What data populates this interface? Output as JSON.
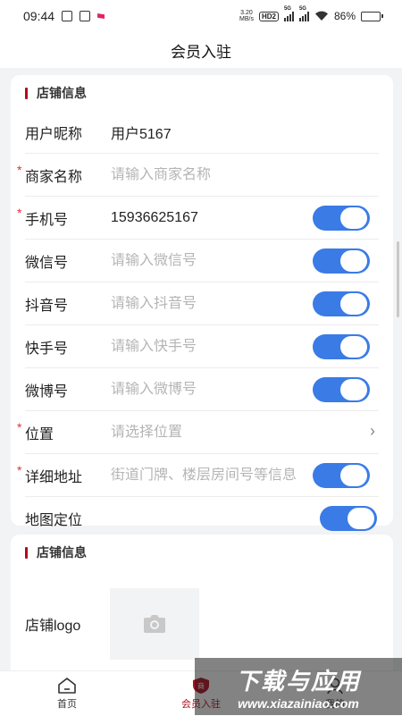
{
  "status_bar": {
    "time": "09:44",
    "net_speed": "3.20\nMB/s",
    "hd": "HD2",
    "signal1": "5G",
    "signal2": "5G",
    "battery": "86%",
    "battery_level": 0.86
  },
  "page": {
    "title": "会员入驻"
  },
  "section1": {
    "title": "店铺信息",
    "fields": [
      {
        "label": "用户昵称",
        "required": false,
        "value": "用户5167",
        "placeholder": "",
        "toggle": null
      },
      {
        "label": "商家名称",
        "required": true,
        "value": "",
        "placeholder": "请输入商家名称",
        "toggle": null
      },
      {
        "label": "手机号",
        "required": true,
        "value": "15936625167",
        "placeholder": "",
        "toggle": true
      },
      {
        "label": "微信号",
        "required": false,
        "value": "",
        "placeholder": "请输入微信号",
        "toggle": true
      },
      {
        "label": "抖音号",
        "required": false,
        "value": "",
        "placeholder": "请输入抖音号",
        "toggle": true
      },
      {
        "label": "快手号",
        "required": false,
        "value": "",
        "placeholder": "请输入快手号",
        "toggle": true
      },
      {
        "label": "微博号",
        "required": false,
        "value": "",
        "placeholder": "请输入微博号",
        "toggle": true
      },
      {
        "label": "位置",
        "required": true,
        "value": "",
        "placeholder": "请选择位置",
        "toggle": null,
        "chevron": "›"
      },
      {
        "label": "详细地址",
        "required": true,
        "value": "",
        "placeholder": "街道门牌、楼层房间号等信息",
        "toggle": true
      },
      {
        "label": "地图定位",
        "required": false,
        "value": "",
        "placeholder": "",
        "toggle": true
      }
    ],
    "required_mark": "*"
  },
  "section2": {
    "title": "店铺信息",
    "logo_label": "店铺logo",
    "upload_icon": "camera-icon"
  },
  "tabbar": {
    "items": [
      {
        "label": "首页",
        "icon": "home-icon",
        "active": false
      },
      {
        "label": "会员入驻",
        "icon": "member-icon",
        "active": true
      },
      {
        "label": "我的",
        "icon": "user-icon",
        "active": false
      }
    ]
  },
  "watermark": {
    "line1": "下载与应用",
    "line2": "www.xiazainiao.com"
  },
  "colors": {
    "accent": "#3a7be6",
    "brand": "#b00d1e",
    "required": "#e0303a"
  }
}
